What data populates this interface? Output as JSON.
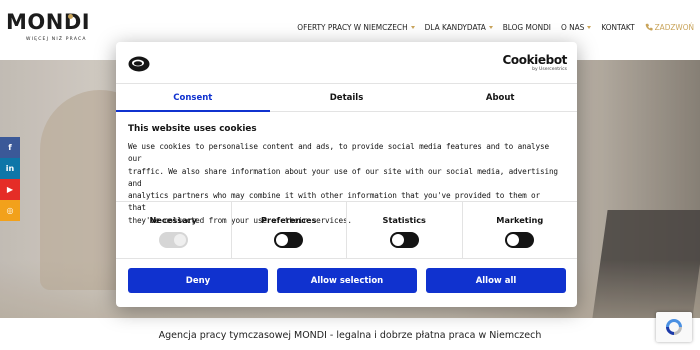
{
  "header": {
    "logo_text": "MONDI",
    "logo_tagline": "WIĘCEJ NIŻ PRACA",
    "nav": [
      {
        "label": "OFERTY PRACY W NIEMCZECH",
        "has_dropdown": true
      },
      {
        "label": "DLA KANDYDATA",
        "has_dropdown": true
      },
      {
        "label": "BLOG MONDI",
        "has_dropdown": false
      },
      {
        "label": "O NAS",
        "has_dropdown": true
      },
      {
        "label": "KONTAKT",
        "has_dropdown": false
      }
    ],
    "call_label": "ZADZWOŃ",
    "call_icon": "phone-icon"
  },
  "social": [
    {
      "name": "facebook-icon",
      "glyph": "f",
      "color": "#3b5998"
    },
    {
      "name": "linkedin-icon",
      "glyph": "in",
      "color": "#0e76a8"
    },
    {
      "name": "youtube-icon",
      "glyph": "▶",
      "color": "#e52d27"
    },
    {
      "name": "instagram-icon",
      "glyph": "◎",
      "color": "#f2a11b"
    }
  ],
  "tagline": "Agencja pracy tymczasowej MONDI - legalna i dobrze płatna praca w Niemczech",
  "cookie_dialog": {
    "brand_name": "Cookiebot",
    "brand_sub": "by Usercentrics",
    "tabs": [
      "Consent",
      "Details",
      "About"
    ],
    "active_tab": "Consent",
    "title": "This website uses cookies",
    "text_lines": [
      "We use cookies to personalise content and ads, to provide social media features and to analyse our",
      "traffic. We also share information about your use of our site with our social media, advertising and",
      "analytics partners who may combine it with other information that you've provided to them or that",
      "they've collected from your use of their services."
    ],
    "preferences": [
      {
        "label": "Necessary",
        "enabled": true,
        "locked": true
      },
      {
        "label": "Preferences",
        "enabled": false,
        "locked": false
      },
      {
        "label": "Statistics",
        "enabled": false,
        "locked": false
      },
      {
        "label": "Marketing",
        "enabled": false,
        "locked": false
      }
    ],
    "buttons": {
      "deny": "Deny",
      "allow_selection": "Allow selection",
      "allow_all": "Allow all"
    },
    "accent_color": "#1032cf"
  },
  "brand_colors": {
    "gold": "#c9a45a"
  }
}
